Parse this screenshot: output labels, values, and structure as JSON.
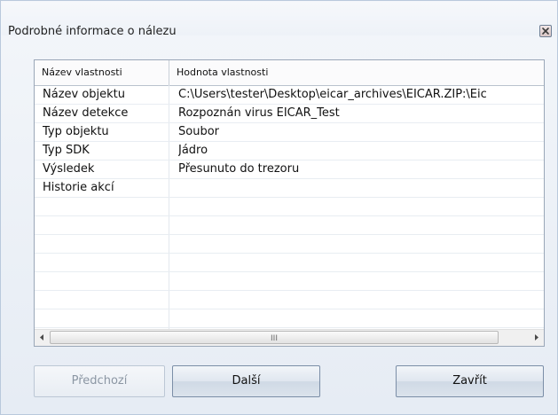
{
  "window": {
    "title": "Podrobné informace o nálezu"
  },
  "table": {
    "headers": {
      "property": "Název vlastnosti",
      "value": "Hodnota vlastnosti"
    },
    "rows": [
      {
        "property": "Název objektu",
        "value": "C:\\Users\\tester\\Desktop\\eicar_archives\\EICAR.ZIP:\\Eic"
      },
      {
        "property": "Název detekce",
        "value": "Rozpoznán virus EICAR_Test"
      },
      {
        "property": "Typ objektu",
        "value": "Soubor"
      },
      {
        "property": "Typ SDK",
        "value": "Jádro"
      },
      {
        "property": "Výsledek",
        "value": "Přesunuto do trezoru"
      },
      {
        "property": "Historie akcí",
        "value": ""
      },
      {
        "property": "",
        "value": ""
      },
      {
        "property": "",
        "value": ""
      },
      {
        "property": "",
        "value": ""
      },
      {
        "property": "",
        "value": ""
      },
      {
        "property": "",
        "value": ""
      },
      {
        "property": "",
        "value": ""
      },
      {
        "property": "",
        "value": ""
      }
    ],
    "scrollbar": {
      "grip": "III"
    }
  },
  "buttons": {
    "previous": "Předchozí",
    "next": "Další",
    "close": "Zavřít"
  },
  "icons": {
    "close": "close-icon",
    "scroll_left": "arrow-left-icon",
    "scroll_right": "arrow-right-icon"
  }
}
